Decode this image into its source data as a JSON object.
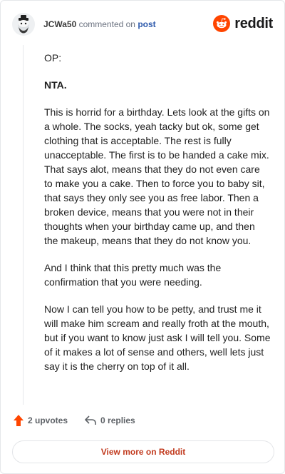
{
  "header": {
    "username": "JCWa50",
    "action_text": "commented on",
    "target": "post",
    "brand": "reddit"
  },
  "comment": {
    "paragraphs": [
      "OP:",
      "NTA.",
      "This is horrid for a birthday. Lets look at the gifts on a whole. The socks, yeah tacky but ok, some get clothing that is acceptable. The rest is fully unacceptable. The first is to be handed a cake mix. That says alot, means that they do not even care to make you a cake. Then to force you to baby sit, that says they only see you as free labor. Then a broken device, means that you were not in their thoughts when your birthday came up, and then the makeup, means that they do not know you.",
      "And I think that this pretty much was the confirmation that you were needing.",
      "Now I can tell you how to be petty, and trust me it will make him scream and really froth at the mouth, but if you want to know just ask I will tell you. Some of it makes a lot of sense and others, well lets just say it is the cherry on top of it all."
    ]
  },
  "actions": {
    "upvotes": "2 upvotes",
    "replies": "0 replies"
  },
  "view_more_label": "View more on Reddit",
  "colors": {
    "upvote_accent": "#ff4500",
    "reddit_orange": "#ff4500",
    "link_blue": "#2e5aac",
    "cta_red": "#c13a1e"
  }
}
